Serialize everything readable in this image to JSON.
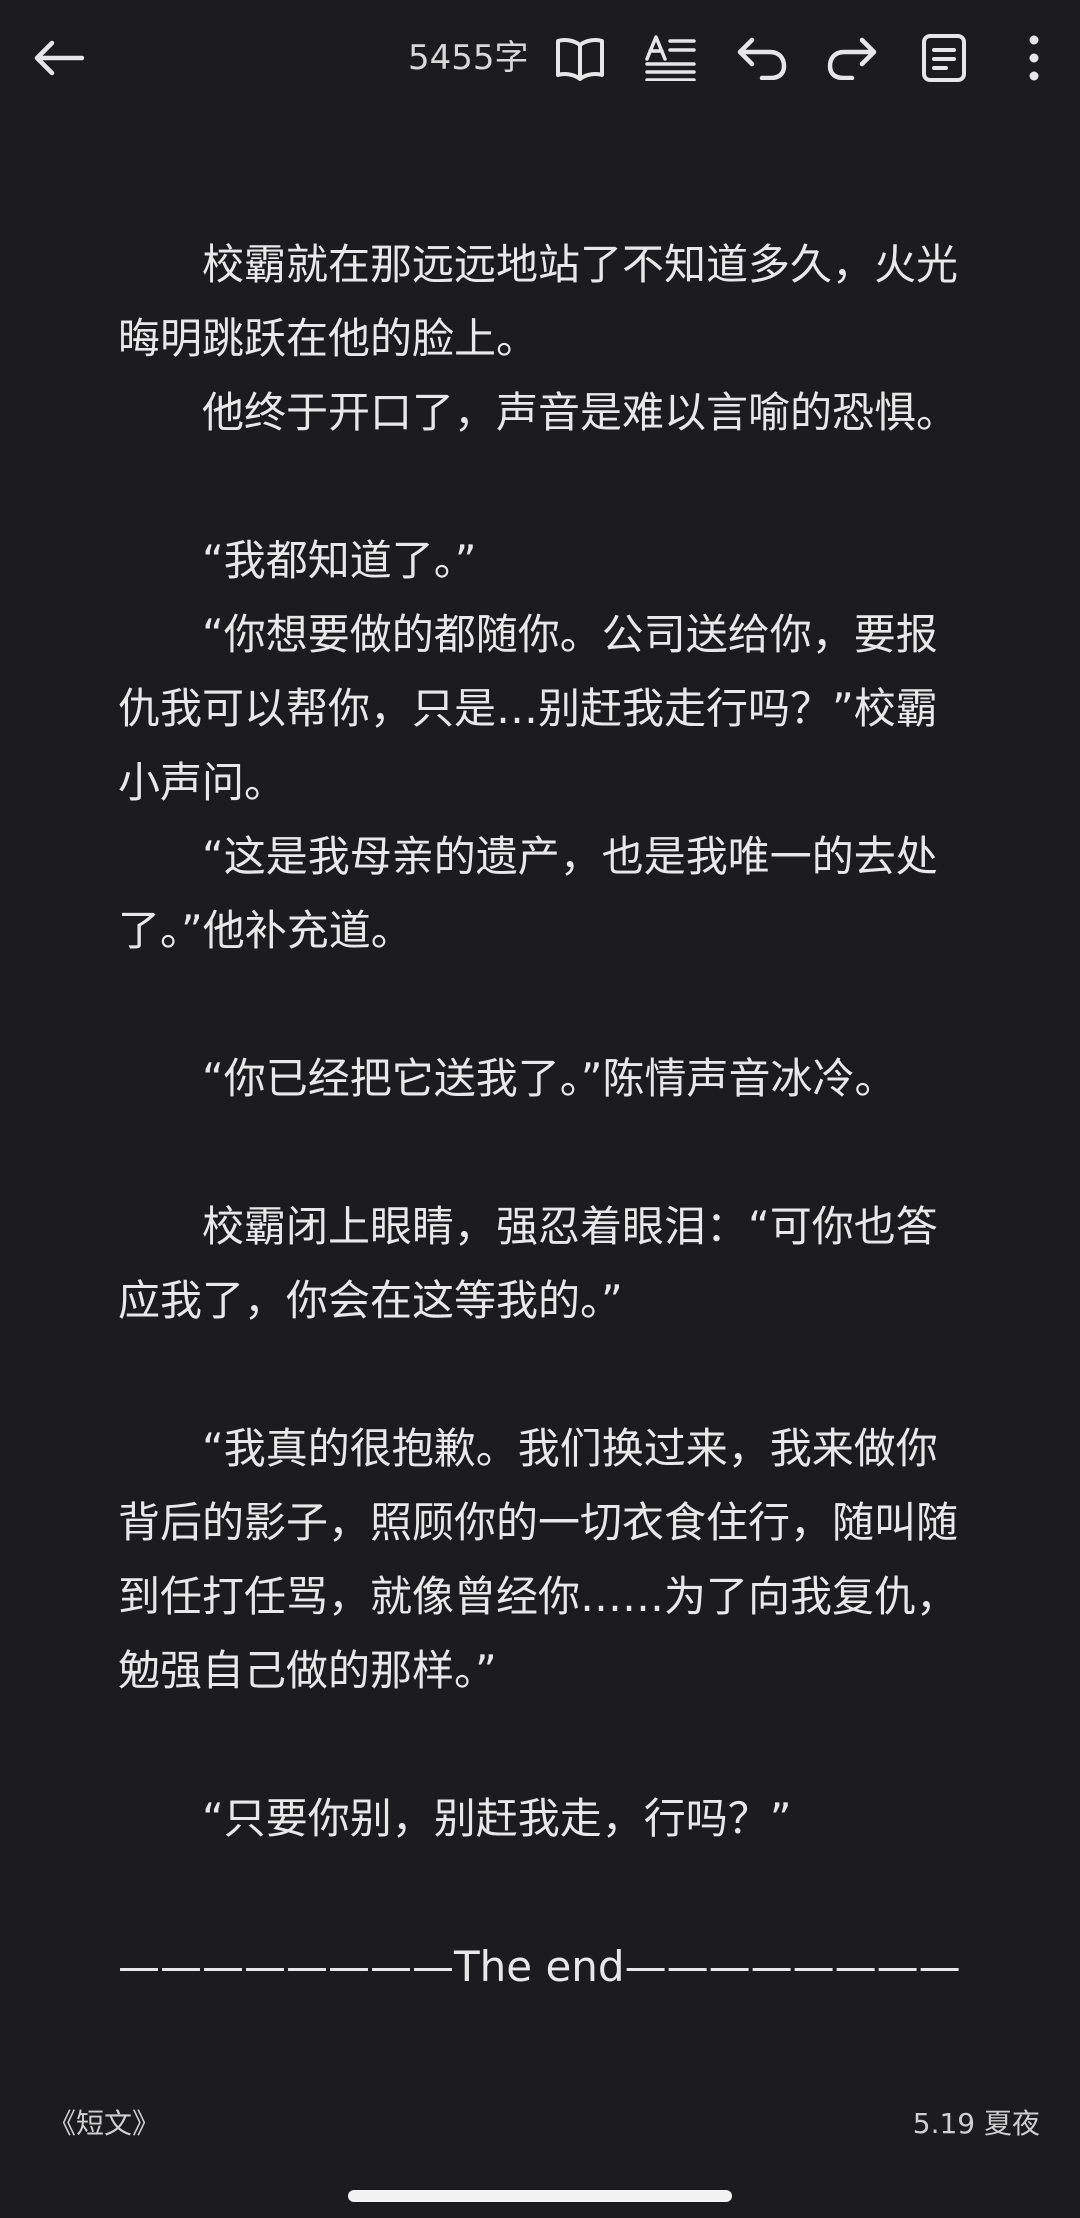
{
  "toolbar": {
    "word_count": "5455字",
    "icons": [
      "back-arrow-icon",
      "book-open-icon",
      "text-format-icon",
      "undo-icon",
      "redo-icon",
      "note-icon",
      "more-vertical-icon"
    ]
  },
  "content": {
    "paragraphs": [
      "校霸就在那远远地站了不知道多久，火光晦明跳跃在他的脸上。",
      "他终于开口了，声音是难以言喻的恐惧。",
      "",
      "“我都知道了。”",
      "“你想要做的都随你。公司送给你，要报仇我可以帮你，只是…别赶我走行吗？”校霸小声问。",
      "“这是我母亲的遗产，也是我唯一的去处了。”他补充道。",
      "",
      "“你已经把它送我了。”陈情声音冰冷。",
      "",
      "校霸闭上眼睛，强忍着眼泪：“可你也答应我了，你会在这等我的。”",
      "",
      "“我真的很抱歉。我们换过来，我来做你背后的影子，照顾你的一切衣食住行，随叫随到任打任骂，就像曾经你……为了向我复仇，勉强自己做的那样。”",
      "",
      "“只要你别，别赶我走，行吗？”",
      ""
    ],
    "the_end": "————————The end————————"
  },
  "footer": {
    "book_title": "《短文》",
    "date_author": "5.19 夏夜"
  }
}
